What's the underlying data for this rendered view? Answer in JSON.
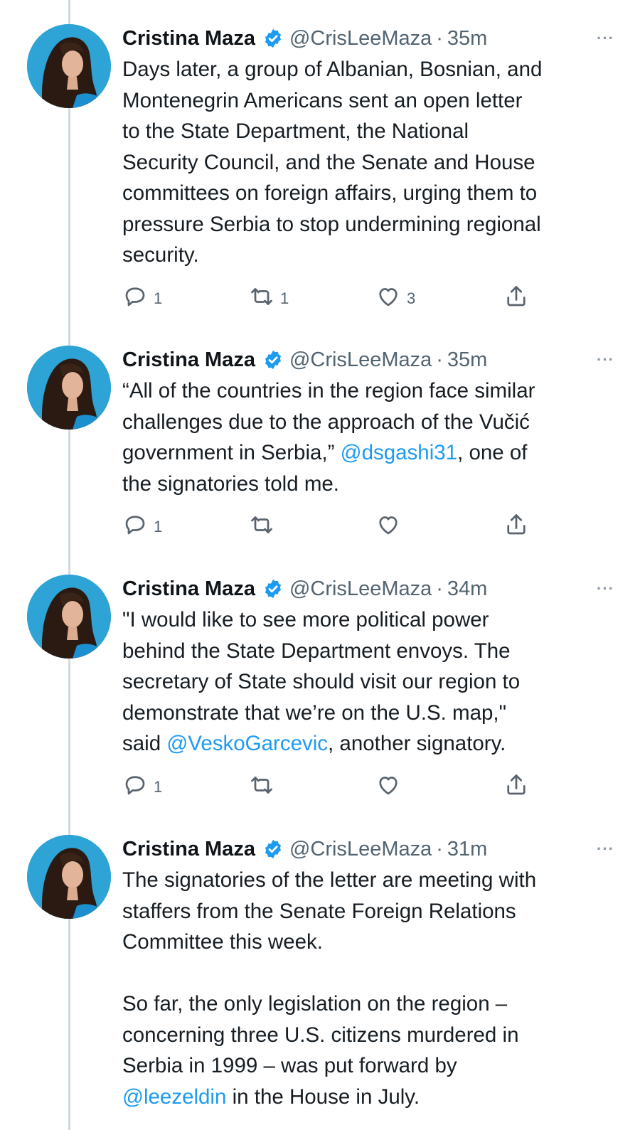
{
  "tweets": [
    {
      "author": "Cristina Maza",
      "handle": "@CrisLeeMaza",
      "time": "35m",
      "text_parts": [
        {
          "t": "Days later, a group of Albanian, Bosnian, and\nMontenegrin Americans sent an open letter\nto the State Department, the National\nSecurity Council, and the Senate and House\ncommittees on foreign affairs, urging them to\npressure Serbia to stop undermining regional\nsecurity."
        }
      ],
      "replies": "1",
      "retweets": "1",
      "likes": "3"
    },
    {
      "author": "Cristina Maza",
      "handle": "@CrisLeeMaza",
      "time": "35m",
      "text_parts": [
        {
          "t": "“All of the countries in the region face similar\nchallenges due to the approach of the Vučić\ngovernment in Serbia,” "
        },
        {
          "t": "@dsgashi31",
          "mention": true
        },
        {
          "t": ", one of\nthe signatories told me."
        }
      ],
      "replies": "1",
      "retweets": "",
      "likes": ""
    },
    {
      "author": "Cristina Maza",
      "handle": "@CrisLeeMaza",
      "time": "34m",
      "text_parts": [
        {
          "t": "\"I would like to see more political power\nbehind the State Department envoys. The\nsecretary of State should visit our region to\ndemonstrate that we’re on the U.S. map,\"\nsaid "
        },
        {
          "t": "@VeskoGarcevic",
          "mention": true
        },
        {
          "t": ", another signatory."
        }
      ],
      "replies": "1",
      "retweets": "",
      "likes": ""
    },
    {
      "author": "Cristina Maza",
      "handle": "@CrisLeeMaza",
      "time": "31m",
      "text_parts": [
        {
          "t": "The signatories of the letter are meeting with\nstaffers from the Senate Foreign Relations\nCommittee this week.\n\nSo far, the only legislation on the region –\nconcerning three U.S. citizens murdered in\nSerbia in 1999 – was put forward by\n"
        },
        {
          "t": "@leezeldin",
          "mention": true
        },
        {
          "t": " in the House in July."
        }
      ],
      "replies": "",
      "retweets": "",
      "likes": ""
    }
  ],
  "icons": {
    "reply": "reply-icon",
    "retweet": "retweet-icon",
    "like": "heart-icon",
    "share": "share-icon",
    "verified": "verified-badge-icon",
    "more": "more-icon"
  },
  "colors": {
    "mention": "#1d9bf0",
    "verified": "#1d9bf0",
    "thread_line": "#cfd9de",
    "secondary_text": "#536471"
  }
}
